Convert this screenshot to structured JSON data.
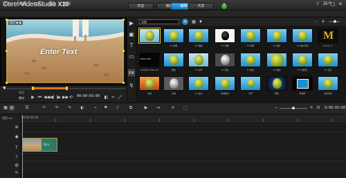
{
  "app": {
    "title_main": "Corel VideoStudio",
    "title_version": "X10",
    "tabs": [
      {
        "label": "欢迎",
        "active": false
      },
      {
        "label": "捕获",
        "active": false
      },
      {
        "label": "编辑",
        "active": true
      },
      {
        "label": "共享",
        "active": false
      }
    ],
    "window_buttons": [
      "?",
      "—",
      "□",
      "✕"
    ]
  },
  "menu": {
    "items": [
      "文件",
      "编辑",
      "工具",
      "设置",
      "帮助"
    ],
    "project_ratio": "16:9"
  },
  "preview": {
    "overlay_label": "项目 ◆ ◆",
    "overlay_text": "Enter Text"
  },
  "transport": {
    "project_label": "项目",
    "clip_label": "素材",
    "timecode": "00:00:03:00",
    "buttons": [
      "⏮",
      "▶",
      "◀◀",
      "◀|",
      "|▶",
      "▶▶",
      "⟲",
      "🔊"
    ]
  },
  "library": {
    "category": "全部",
    "toolbar_icons": [
      "▦",
      "♦",
      "⋯"
    ],
    "rail": [
      "▶",
      "▣",
      "T",
      "▭",
      "FX",
      "↯"
    ],
    "thumbnails": [
      {
        "caption": "",
        "style": "cloud-balloon"
      },
      {
        "caption": "FX 画笔",
        "style": "balloon"
      },
      {
        "caption": "FX 扭曲",
        "style": "balloon"
      },
      {
        "caption": "FX 浮雕",
        "style": "white"
      },
      {
        "caption": "FX 喷雾",
        "style": "balloon"
      },
      {
        "caption": "FX 星空",
        "style": "balloon"
      },
      {
        "caption": "FX 色彩平衡",
        "style": "balloon"
      },
      {
        "caption": "Mosaic 3",
        "style": "gold"
      },
      {
        "caption": "Multiple Titles 03",
        "style": "dark-text",
        "text": "Enter Text"
      },
      {
        "caption": "颗粒",
        "style": "balloon"
      },
      {
        "caption": "FX 反转",
        "style": "cloud-balloon"
      },
      {
        "caption": "FX 灰度",
        "style": "gray"
      },
      {
        "caption": "FX 强化",
        "style": "balloon"
      },
      {
        "caption": "FX 焦点",
        "style": "big-balloon"
      },
      {
        "caption": "FX 马赛克",
        "style": "balloon"
      },
      {
        "caption": "FX 云彩",
        "style": "balloon"
      },
      {
        "caption": "光线",
        "style": "orange-balloon"
      },
      {
        "caption": "闪电",
        "style": "gray"
      },
      {
        "caption": "FX 镜头",
        "style": "balloon"
      },
      {
        "caption": "自动曝光",
        "style": "balloon"
      },
      {
        "caption": "光芒",
        "style": "small-balloon"
      },
      {
        "caption": "阴影",
        "style": "dark-balloon"
      },
      {
        "caption": "老电影",
        "style": "dark-frame"
      },
      {
        "caption": "自动草绘",
        "style": "balloon"
      }
    ]
  },
  "timeline": {
    "label": "项目 ▾ ▾",
    "timecode": "0:00:03:00",
    "ruler_tc": "00:00:00:00",
    "clip_name": "Fyrs",
    "toolbar_icons": [
      "▦",
      "▤",
      "↶",
      "↷",
      "✎",
      "◐",
      "⌁",
      "⚑",
      "♪",
      "⧉",
      "▶",
      "↔",
      "⌗",
      "⬚"
    ],
    "track_icons": [
      "⊕",
      "◉",
      "T",
      "♪",
      "◍",
      "✎",
      "⌁"
    ]
  }
}
